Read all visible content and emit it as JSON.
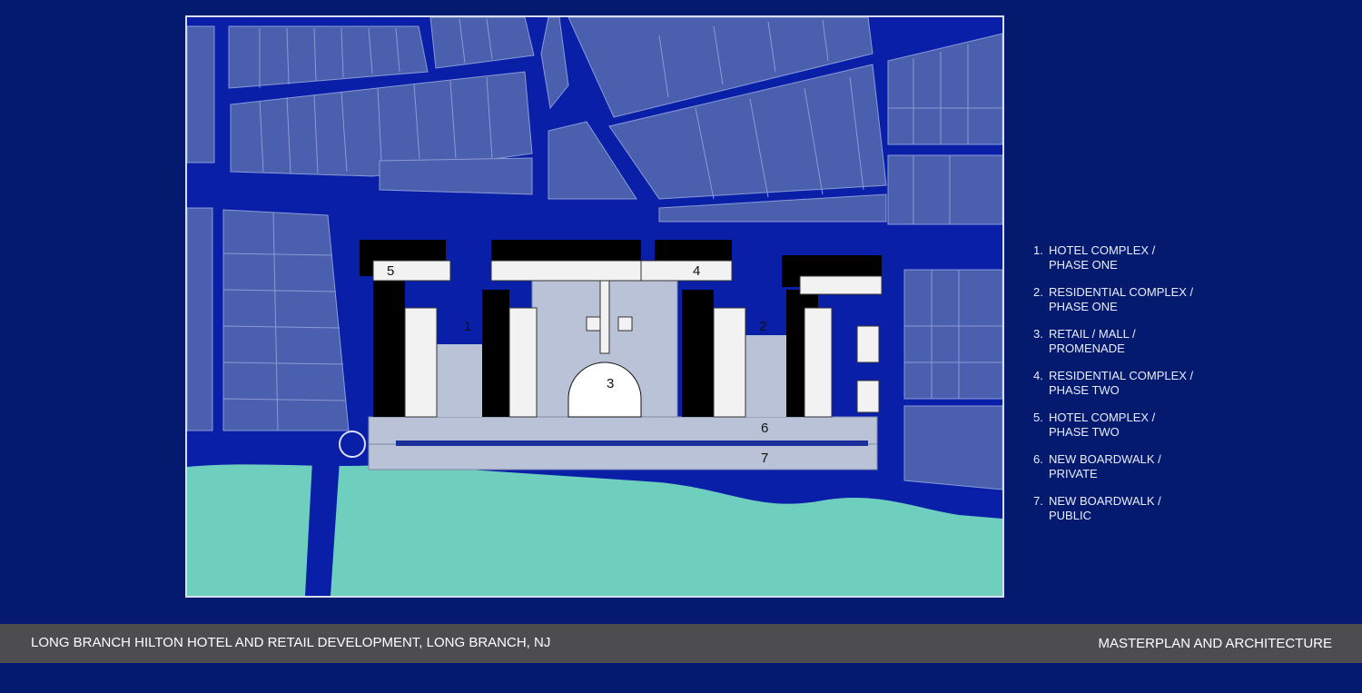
{
  "plan": {
    "labels": [
      "1",
      "2",
      "3",
      "4",
      "5",
      "6",
      "7"
    ]
  },
  "legend": [
    {
      "num": "1.",
      "text": "HOTEL COMPLEX /\nPHASE ONE"
    },
    {
      "num": "2.",
      "text": "RESIDENTIAL COMPLEX /\nPHASE ONE"
    },
    {
      "num": "3.",
      "text": "RETAIL / MALL /\nPROMENADE"
    },
    {
      "num": "4.",
      "text": "RESIDENTIAL COMPLEX /\nPHASE TWO"
    },
    {
      "num": "5.",
      "text": "HOTEL COMPLEX /\nPHASE TWO"
    },
    {
      "num": "6.",
      "text": "NEW BOARDWALK /\nPRIVATE"
    },
    {
      "num": "7.",
      "text": "NEW BOARDWALK /\nPUBLIC"
    }
  ],
  "footer": {
    "project": "LONG BRANCH HILTON HOTEL AND RETAIL DEVELOPMENT, LONG BRANCH, NJ",
    "category": "MASTERPLAN AND ARCHITECTURE"
  },
  "colors": {
    "background": "#041a6e",
    "roads": "#0a1fa8",
    "blocks": "#4a5fad",
    "ocean": "#6fcfbf",
    "buildings": "#f2f2f2",
    "plaza": "#b9c2d6",
    "footer_bar": "#4d4d4f"
  }
}
